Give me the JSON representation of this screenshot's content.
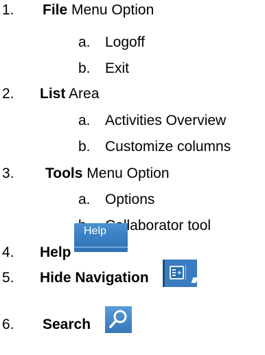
{
  "items": [
    {
      "number": "1.",
      "bold": "File",
      "rest": " Menu Option",
      "subitems": [
        {
          "letter": "a.",
          "text": "Logoff"
        },
        {
          "letter": "b.",
          "text": "Exit"
        }
      ]
    },
    {
      "number": "2.",
      "bold": "List",
      "rest": " Area",
      "subitems": [
        {
          "letter": "a.",
          "text": "Activities Overview"
        },
        {
          "letter": "b.",
          "text": "Customize columns"
        }
      ]
    },
    {
      "number": "3.",
      "bold": "Tools",
      "rest": " Menu Option",
      "subitems": [
        {
          "letter": "a.",
          "text": "Options"
        },
        {
          "letter": "b.",
          "text": "Collaborator tool"
        }
      ]
    },
    {
      "number": "4.",
      "bold": "Help",
      "image_label": "Help",
      "icon": "help-button-image"
    },
    {
      "number": "5.",
      "bold": "Hide Navigation",
      "icon": "hide-navigation-icon"
    },
    {
      "number": "6.",
      "bold": "Search",
      "icon": "search-icon"
    }
  ],
  "colors": {
    "button_blue": "#3a80c2",
    "icon_white": "#ffffff"
  }
}
